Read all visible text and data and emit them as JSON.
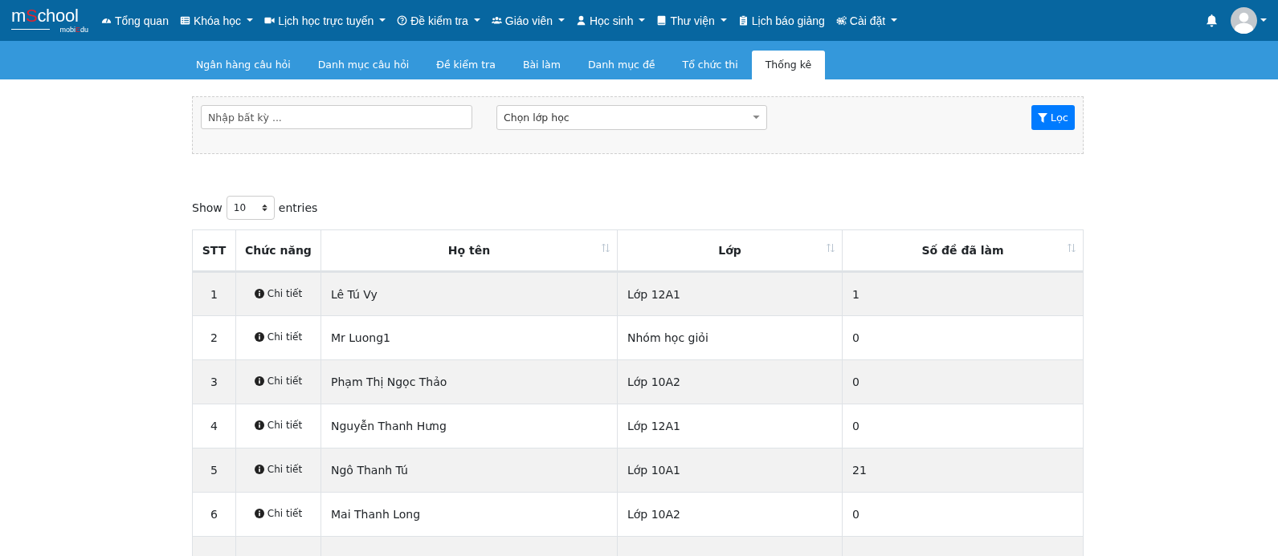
{
  "logo": {
    "name_parts": [
      {
        "text": "m",
        "accent": false
      },
      {
        "text": "S",
        "accent": true
      },
      {
        "text": "chool",
        "accent": false
      }
    ],
    "sub_parts": [
      {
        "text": "mobi",
        "accent": false
      },
      {
        "text": "E",
        "accent": true
      },
      {
        "text": "du",
        "accent": false
      }
    ]
  },
  "nav": [
    {
      "label": "Tổng quan",
      "kind": "gauge",
      "dropdown": false
    },
    {
      "label": "Khóa học",
      "kind": "list",
      "dropdown": true
    },
    {
      "label": "Lịch học trực tuyến",
      "kind": "video",
      "dropdown": true
    },
    {
      "label": "Đề kiểm tra",
      "kind": "question",
      "dropdown": true
    },
    {
      "label": "Giáo viên",
      "kind": "users",
      "dropdown": true
    },
    {
      "label": "Học sinh",
      "kind": "user",
      "dropdown": true
    },
    {
      "label": "Thư viện",
      "kind": "book",
      "dropdown": true
    },
    {
      "label": "Lịch báo giảng",
      "kind": "clipboard",
      "dropdown": false
    },
    {
      "label": "Cài đặt",
      "kind": "gears",
      "dropdown": true
    }
  ],
  "tabs": [
    {
      "label": "Ngân hàng câu hỏi",
      "selected": false
    },
    {
      "label": "Danh mục câu hỏi",
      "selected": false
    },
    {
      "label": "Đề kiểm tra",
      "selected": false
    },
    {
      "label": "Bài làm",
      "selected": false
    },
    {
      "label": "Danh mục đề",
      "selected": false
    },
    {
      "label": "Tổ chức thi",
      "selected": false
    },
    {
      "label": "Thống kê",
      "selected": true
    }
  ],
  "filter": {
    "search": {
      "placeholder": "Nhập bất kỳ ..."
    },
    "class_select": {
      "placeholder": "Chọn lớp học"
    },
    "button": "Lọc"
  },
  "length": {
    "prefix": "Show",
    "value": "10",
    "suffix": "entries"
  },
  "table": {
    "columns": [
      {
        "label": "STT",
        "sortable": false
      },
      {
        "label": "Chức năng",
        "sortable": false
      },
      {
        "label": "Họ tên",
        "sortable": true
      },
      {
        "label": "Lớp",
        "sortable": true
      },
      {
        "label": "Số đề đã làm",
        "sortable": true
      }
    ],
    "rows": [
      {
        "stt": "1",
        "action": "Chi tiết",
        "name": "Lê Tú Vy",
        "class": "Lớp 12A1",
        "count": "1"
      },
      {
        "stt": "2",
        "action": "Chi tiết",
        "name": "Mr Luong1",
        "class": "Nhóm học giỏi",
        "count": "0"
      },
      {
        "stt": "3",
        "action": "Chi tiết",
        "name": "Phạm Thị Ngọc Thảo",
        "class": "Lớp 10A2",
        "count": "0"
      },
      {
        "stt": "4",
        "action": "Chi tiết",
        "name": "Nguyễn Thanh Hưng",
        "class": "Lớp 12A1",
        "count": "0"
      },
      {
        "stt": "5",
        "action": "Chi tiết",
        "name": "Ngô Thanh Tú",
        "class": "Lớp 10A1",
        "count": "21"
      },
      {
        "stt": "6",
        "action": "Chi tiết",
        "name": "Mai Thanh Long",
        "class": "Lớp 10A2",
        "count": "0"
      }
    ]
  }
}
